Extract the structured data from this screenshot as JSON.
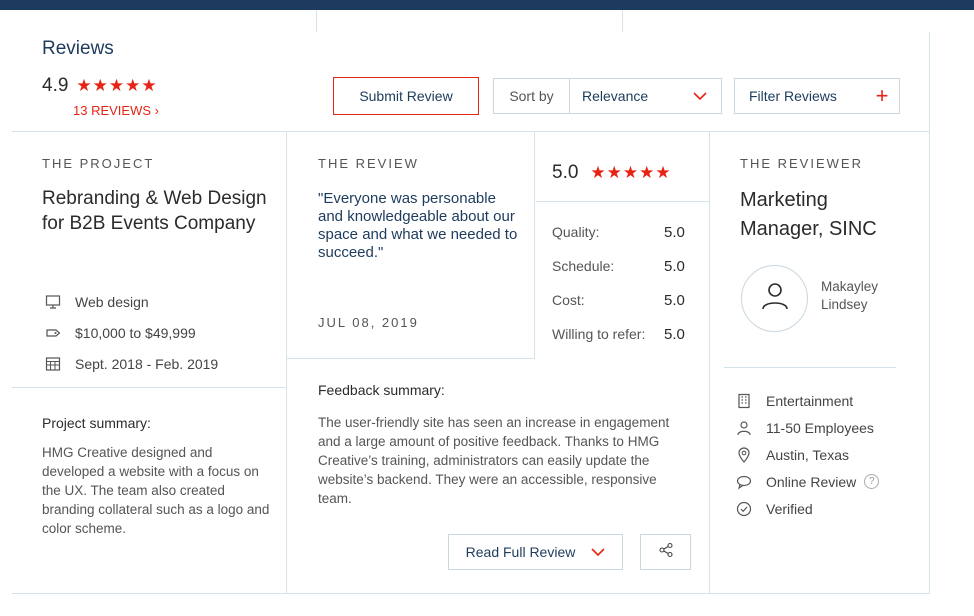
{
  "header": {
    "title": "Reviews",
    "rating": "4.9",
    "stars": "★★★★★",
    "review_count": "13 REVIEWS",
    "count_chevron": "›",
    "submit_label": "Submit Review",
    "sort_label": "Sort by",
    "sort_value": "Relevance",
    "filter_label": "Filter Reviews",
    "filter_plus": "+"
  },
  "project": {
    "heading": "THE PROJECT",
    "title": "Rebranding & Web Design for B2B Events Company",
    "meta": [
      {
        "icon": "monitor-icon",
        "text": "Web design"
      },
      {
        "icon": "price-tag-icon",
        "text": "$10,000 to $49,999"
      },
      {
        "icon": "calendar-icon",
        "text": "Sept. 2018 - Feb. 2019"
      }
    ],
    "summary_heading": "Project summary:",
    "summary": "HMG Creative designed and developed a website with a focus on the UX. The team also created branding collateral such as a logo and color scheme."
  },
  "review": {
    "heading": "THE REVIEW",
    "quote": "\"Everyone was personable and knowledgeable about our space and what we needed to succeed.\"",
    "date": "JUL 08, 2019",
    "overall": "5.0",
    "stars": "★★★★★",
    "scores": [
      {
        "label": "Quality:",
        "value": "5.0"
      },
      {
        "label": "Schedule:",
        "value": "5.0"
      },
      {
        "label": "Cost:",
        "value": "5.0"
      },
      {
        "label": "Willing to refer:",
        "value": "5.0"
      }
    ],
    "feedback_heading": "Feedback summary:",
    "feedback": "The user-friendly site has seen an increase in engagement and a large amount of positive feedback. Thanks to HMG Creative’s training, administrators can easily update the website’s backend. They were an accessible, responsive team.",
    "read_full_label": "Read Full Review"
  },
  "reviewer": {
    "heading": "THE REVIEWER",
    "title": "Marketing Manager, SINC",
    "name": "Makayley Lindsey",
    "meta": [
      {
        "icon": "building-icon",
        "text": "Entertainment"
      },
      {
        "icon": "person-icon",
        "text": "11-50 Employees"
      },
      {
        "icon": "location-pin-icon",
        "text": "Austin, Texas"
      },
      {
        "icon": "chat-bubble-icon",
        "text": "Online Review"
      },
      {
        "icon": "check-circle-icon",
        "text": "Verified"
      }
    ],
    "help": "?"
  },
  "colors": {
    "accent": "#e62415",
    "navy": "#1d3b5c",
    "border": "#d7e3ea"
  }
}
